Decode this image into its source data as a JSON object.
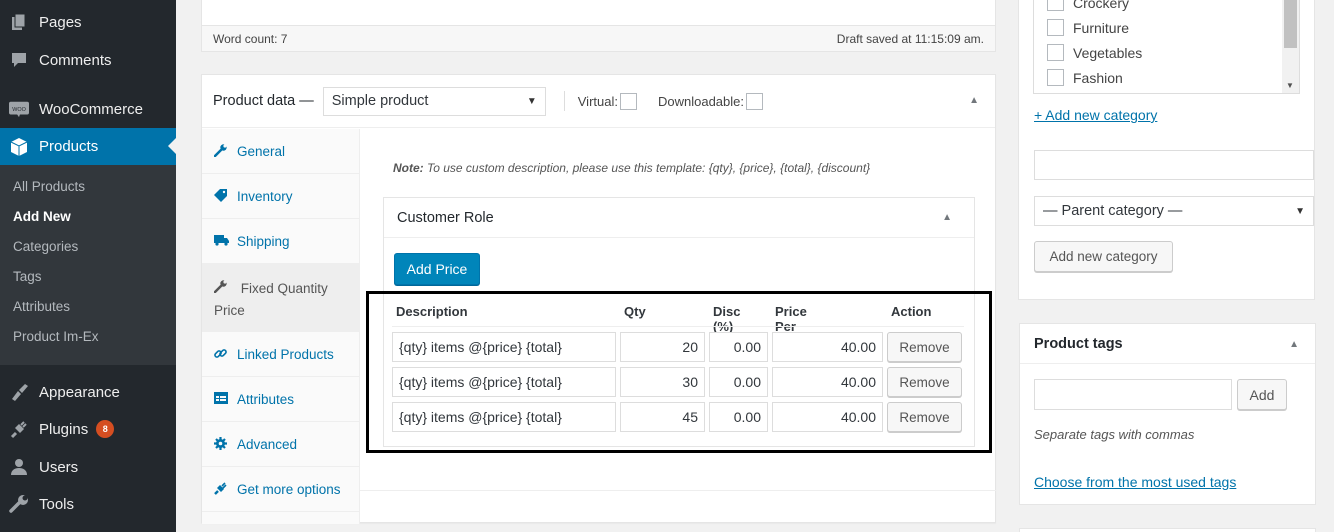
{
  "sidebar": {
    "items": [
      {
        "label": "Pages",
        "icon": "pages-icon"
      },
      {
        "label": "Comments",
        "icon": "comments-icon"
      },
      {
        "label": "WooCommerce",
        "icon": "woocommerce-icon"
      },
      {
        "label": "Products",
        "icon": "products-icon",
        "current": true
      },
      {
        "label": "Appearance",
        "icon": "appearance-icon"
      },
      {
        "label": "Plugins",
        "icon": "plugins-icon",
        "badge": "8"
      },
      {
        "label": "Users",
        "icon": "users-icon"
      },
      {
        "label": "Tools",
        "icon": "tools-icon"
      }
    ],
    "submenu": [
      {
        "label": "All Products"
      },
      {
        "label": "Add New",
        "current": true
      },
      {
        "label": "Categories"
      },
      {
        "label": "Tags"
      },
      {
        "label": "Attributes"
      },
      {
        "label": "Product Im-Ex"
      }
    ]
  },
  "editor": {
    "word_count": "Word count: 7",
    "draft_status": "Draft saved at 11:15:09 am."
  },
  "product_data": {
    "title": "Product data —",
    "type_select": "Simple product",
    "virtual_label": "Virtual:",
    "virtual_checked": false,
    "downloadable_label": "Downloadable:",
    "downloadable_checked": false,
    "tabs": [
      {
        "label": "General",
        "icon": "wrench-icon"
      },
      {
        "label": "Inventory",
        "icon": "tag-icon"
      },
      {
        "label": "Shipping",
        "icon": "truck-icon"
      },
      {
        "label": "Fixed Quantity Price",
        "icon": "wrench-icon",
        "active": true
      },
      {
        "label": "Linked Products",
        "icon": "link-icon"
      },
      {
        "label": "Attributes",
        "icon": "list-icon"
      },
      {
        "label": "Advanced",
        "icon": "gear-icon"
      },
      {
        "label": "Get more options",
        "icon": "plugin-icon"
      }
    ],
    "note_label": "Note:",
    "note_text": " To use custom description, please use this template: {qty}, {price}, {total}, {discount}",
    "role_title": "Customer Role",
    "add_price_label": "Add Price",
    "table": {
      "headers": [
        "Description",
        "Qty",
        "Disc (%)",
        "Price Per Qty",
        "Action"
      ],
      "rows": [
        {
          "description": "{qty} items @{price} {total}",
          "qty": "20",
          "disc": "0.00",
          "price": "40.00",
          "action": "Remove"
        },
        {
          "description": "{qty} items @{price} {total}",
          "qty": "30",
          "disc": "0.00",
          "price": "40.00",
          "action": "Remove"
        },
        {
          "description": "{qty} items @{price} {total}",
          "qty": "45",
          "disc": "0.00",
          "price": "40.00",
          "action": "Remove"
        }
      ]
    }
  },
  "categories": {
    "items": [
      {
        "label": "Crockery",
        "checked": false
      },
      {
        "label": "Furniture",
        "checked": false
      },
      {
        "label": "Vegetables",
        "checked": false
      },
      {
        "label": "Fashion",
        "checked": false
      }
    ],
    "add_link": "+ Add new category",
    "new_category_value": "",
    "parent_select": "— Parent category —",
    "add_button": "Add new category"
  },
  "tags": {
    "title": "Product tags",
    "input_value": "",
    "add_button": "Add",
    "hint": "Separate tags with commas",
    "choose_link": "Choose from the most used tags"
  },
  "colors": {
    "admin_bar": "#23282d",
    "accent": "#0073aa",
    "button_primary": "#0085ba",
    "badge": "#d54e21"
  }
}
